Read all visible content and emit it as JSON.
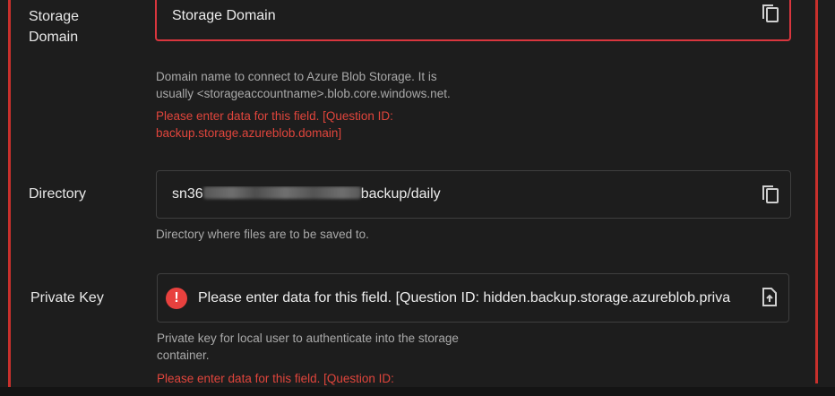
{
  "storage_domain": {
    "label_line1": "Storage",
    "label_line2": "Domain",
    "value": "Storage Domain",
    "help_line1": "Domain name to connect to Azure Blob Storage.  It is",
    "help_line2": "usually <storageaccountname>.blob.core.windows.net.",
    "error_line1": "Please enter data for this field. [Question ID:",
    "error_line2": "backup.storage.azureblob.domain]",
    "icon": "copy-icon"
  },
  "directory": {
    "label": "Directory",
    "value_prefix": "sn36",
    "value_suffix": "backup/daily",
    "help": "Directory where files are to be saved to.",
    "icon": "copy-icon"
  },
  "private_key": {
    "label": "Private Key",
    "value": "Please enter data for this field. [Question ID: hidden.backup.storage.azureblob.priva",
    "help_line1": "Private key for local user to authenticate into the storage",
    "help_line2": "container.",
    "error_line1": "Please enter data for this field. [Question ID:",
    "status_icon": "alert-circle-icon",
    "icon": "upload-file-icon"
  },
  "colors": {
    "error": "#e0453c",
    "background": "#1d1d1d",
    "help_text": "#a9a9a9"
  }
}
